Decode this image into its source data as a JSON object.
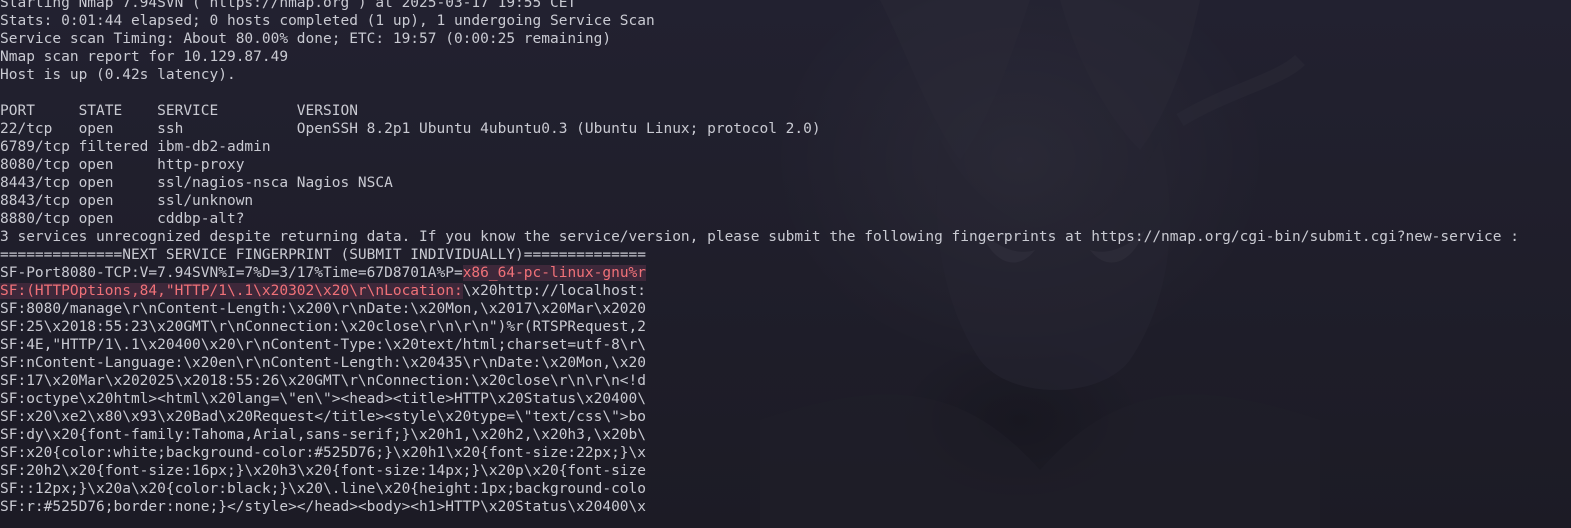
{
  "colors": {
    "background": "#1e1d27",
    "text": "#c9cad2",
    "highlight_text": "#f07178",
    "highlight_bg": "#4a2f45"
  },
  "output_lines": [
    {
      "text": "Starting Nmap 7.94SVN ( https://nmap.org ) at 2025-03-17 19:55 CET"
    },
    {
      "text": "Stats: 0:01:44 elapsed; 0 hosts completed (1 up), 1 undergoing Service Scan"
    },
    {
      "text": "Service scan Timing: About 80.00% done; ETC: 19:57 (0:00:25 remaining)"
    },
    {
      "text": "Nmap scan report for 10.129.87.49"
    },
    {
      "text": "Host is up (0.42s latency)."
    },
    {
      "text": ""
    },
    {
      "text": "PORT     STATE    SERVICE         VERSION"
    },
    {
      "text": "22/tcp   open     ssh             OpenSSH 8.2p1 Ubuntu 4ubuntu0.3 (Ubuntu Linux; protocol 2.0)"
    },
    {
      "text": "6789/tcp filtered ibm-db2-admin"
    },
    {
      "text": "8080/tcp open     http-proxy"
    },
    {
      "text": "8443/tcp open     ssl/nagios-nsca Nagios NSCA"
    },
    {
      "text": "8843/tcp open     ssl/unknown"
    },
    {
      "text": "8880/tcp open     cddbp-alt?"
    },
    {
      "text": "3 services unrecognized despite returning data. If you know the service/version, please submit the following fingerprints at https://nmap.org/cgi-bin/submit.cgi?new-service :"
    },
    {
      "text": "==============NEXT SERVICE FINGERPRINT (SUBMIT INDIVIDUALLY)=============="
    },
    {
      "text": "SF-Port8080-TCP:V=7.94SVN%I=7%D=3/17%Time=67D8701A%P=",
      "highlight": "x86_64-pc-linux-gnu%r"
    },
    {
      "text": "",
      "highlight": "SF:(HTTPOptions,84,\"HTTP/1\\.1\\x20302\\x20\\r\\nLocation:",
      "rest": "\\x20http://localhost:"
    },
    {
      "text": "SF:8080/manage\\r\\nContent-Length:\\x200\\r\\nDate:\\x20Mon,\\x2017\\x20Mar\\x2020"
    },
    {
      "text": "SF:25\\x2018:55:23\\x20GMT\\r\\nConnection:\\x20close\\r\\n\\r\\n\")%r(RTSPRequest,2"
    },
    {
      "text": "SF:4E,\"HTTP/1\\.1\\x20400\\x20\\r\\nContent-Type:\\x20text/html;charset=utf-8\\r\\"
    },
    {
      "text": "SF:nContent-Language:\\x20en\\r\\nContent-Length:\\x20435\\r\\nDate:\\x20Mon,\\x20"
    },
    {
      "text": "SF:17\\x20Mar\\x202025\\x2018:55:26\\x20GMT\\r\\nConnection:\\x20close\\r\\n\\r\\n<!d"
    },
    {
      "text": "SF:octype\\x20html><html\\x20lang=\\\"en\\\"><head><title>HTTP\\x20Status\\x20400\\"
    },
    {
      "text": "SF:x20\\xe2\\x80\\x93\\x20Bad\\x20Request</title><style\\x20type=\\\"text/css\\\">bo"
    },
    {
      "text": "SF:dy\\x20{font-family:Tahoma,Arial,sans-serif;}\\x20h1,\\x20h2,\\x20h3,\\x20b\\"
    },
    {
      "text": "SF:x20{color:white;background-color:#525D76;}\\x20h1\\x20{font-size:22px;}\\x"
    },
    {
      "text": "SF:20h2\\x20{font-size:16px;}\\x20h3\\x20{font-size:14px;}\\x20p\\x20{font-size"
    },
    {
      "text": "SF::12px;}\\x20a\\x20{color:black;}\\x20\\.line\\x20{height:1px;background-colo"
    },
    {
      "text": "SF:r:#525D76;border:none;}</style></head><body><h1>HTTP\\x20Status\\x20400\\x"
    }
  ]
}
